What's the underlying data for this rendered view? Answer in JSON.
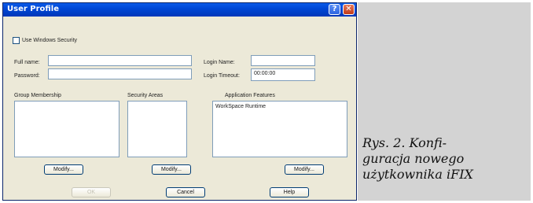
{
  "window": {
    "title": "User Profile",
    "help_glyph": "?",
    "close_glyph": "✕"
  },
  "form": {
    "use_windows_security_label": "Use Windows Security",
    "use_windows_security_checked": false,
    "full_name_label": "Full name:",
    "full_name_value": "",
    "password_label": "Password:",
    "password_value": "",
    "login_name_label": "Login Name:",
    "login_name_value": "",
    "login_timeout_label": "Login Timeout:",
    "login_timeout_value": "00:00:00"
  },
  "groups": {
    "group_membership_label": "Group Membership",
    "security_areas_label": "Security Areas",
    "application_features_label": "Application Features",
    "application_features_items": [
      "WorkSpace Runtime"
    ],
    "modify_label": "Modify..."
  },
  "buttons": {
    "ok": "OK",
    "cancel": "Cancel",
    "help": "Help"
  },
  "caption": {
    "line1": "Rys. 2. Konfi-",
    "line2": "guracja nowego",
    "line3": "użytkownika iFIX"
  }
}
